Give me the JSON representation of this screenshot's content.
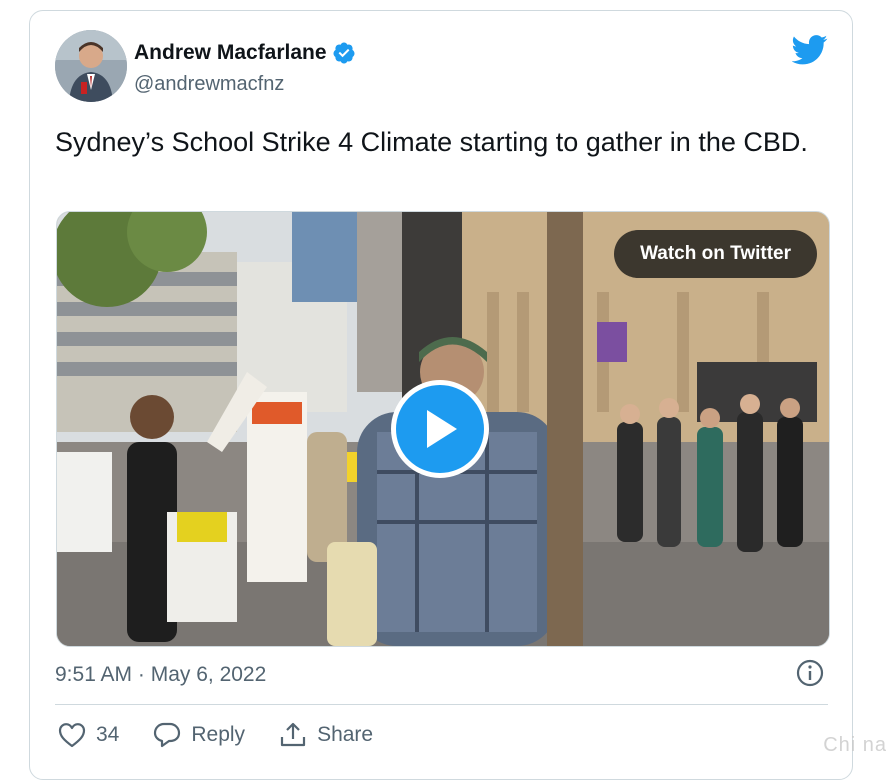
{
  "tweet": {
    "author_name": "Andrew Macfarlane",
    "author_handle": "@andrewmacfnz",
    "text": "Sydney’s School Strike 4 Climate starting to gather in the CBD.",
    "timestamp": "9:51 AM · May 6, 2022"
  },
  "media": {
    "watch_label": "Watch on Twitter"
  },
  "actions": {
    "like_count": "34",
    "reply_label": "Reply",
    "share_label": "Share"
  },
  "watermark": "Chi na",
  "icons": {
    "verified": "verified-badge-icon",
    "brand": "twitter-bird-icon",
    "play": "play-icon",
    "info": "info-icon",
    "like": "heart-icon",
    "reply": "speech-bubble-icon",
    "share": "share-upload-icon"
  },
  "colors": {
    "brand_blue": "#1d9bf0",
    "text_primary": "#0f1419",
    "text_secondary": "#536471",
    "border": "#cfd9de"
  }
}
